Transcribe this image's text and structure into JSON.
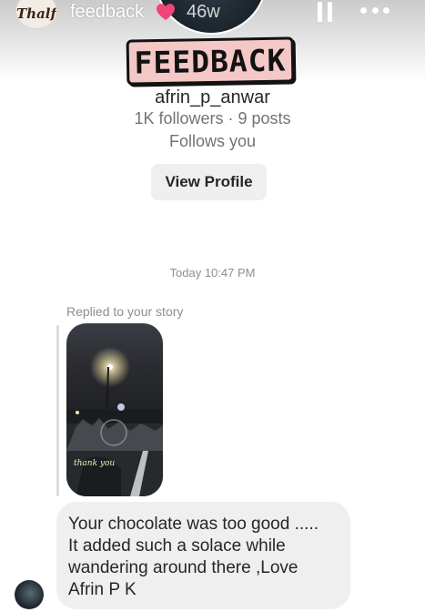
{
  "story_header": {
    "title": "feedback",
    "age": "46w",
    "brand_logo_text": "Thalf"
  },
  "sticker": {
    "text": "FEEDBACK"
  },
  "profile": {
    "username": "afrin_p_anwar",
    "stats": "1K followers · 9 posts",
    "follows_you": "Follows you",
    "view_profile_label": "View Profile"
  },
  "conversation": {
    "timestamp": "Today 10:47 PM",
    "reply_context": "Replied to your story",
    "story_thumbnail_caption": "thank you",
    "message": "Your chocolate was too good .....\nIt added such a solace while\nwandering around there ,Love\nAfrin P K"
  },
  "colors": {
    "heart": "#f0447b",
    "sticker_background": "#f3c8c7",
    "bubble_background": "#efefef",
    "button_background": "#efefef"
  },
  "icons": [
    "heart-icon",
    "pause-icon",
    "more-options-icon"
  ]
}
